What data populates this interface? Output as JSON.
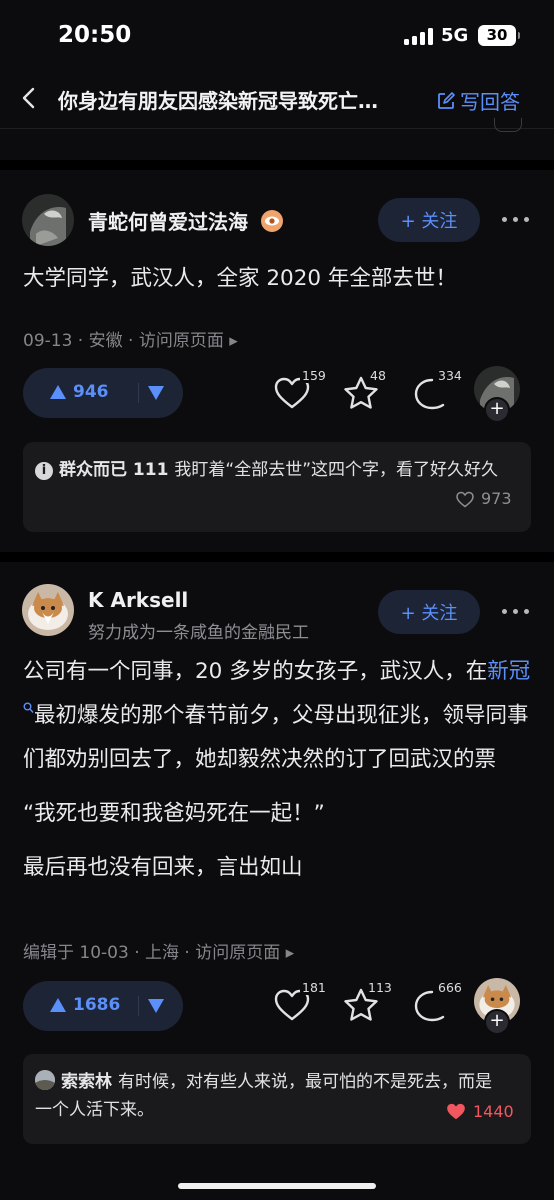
{
  "status": {
    "time": "20:50",
    "network": "5G",
    "battery": "30"
  },
  "nav": {
    "title": "你身边有朋友因感染新冠导致死亡…",
    "write_label": "写回答"
  },
  "answers": [
    {
      "author": "青蛇何曾爱过法海",
      "follow_label": "+ 关注",
      "content": [
        "大学同学，武汉人，全家 2020 年全部去世！"
      ],
      "meta": "09-13 · 安徽 · 访问原页面 ▸",
      "votes": "946",
      "likes": "159",
      "favorites": "48",
      "comments": "334",
      "top_comment": {
        "name": "群众而已 111",
        "text": "我盯着“全部去世”这四个字，看了好久好久",
        "likes": "973"
      }
    },
    {
      "author": "K Arksell",
      "subtitle": "努力成为一条咸鱼的金融民工",
      "follow_label": "+ 关注",
      "content_p1_before": "公司有一个同事，20 多岁的女孩子，武汉人，在",
      "content_p1_link": "新冠",
      "content_p1_after": "最初爆发的那个春节前夕，父母出现征兆，领导同事们都劝别回去了，她却毅然决然的订了回武汉的票",
      "content_p2": "“我死也要和我爸妈死在一起！”",
      "content_p3": "最后再也没有回来，言出如山",
      "meta": "编辑于 10-03 · 上海 · 访问原页面 ▸",
      "votes": "1686",
      "likes": "181",
      "favorites": "113",
      "comments": "666",
      "top_comment": {
        "name": "索索林",
        "text": "有时候，对有些人来说，最可怕的不是死去，而是一个人活下来。",
        "likes": "1440"
      }
    }
  ],
  "colors": {
    "accent": "#5b8ff9",
    "background": "#0c0c0e",
    "hot_like": "#f2575f"
  }
}
